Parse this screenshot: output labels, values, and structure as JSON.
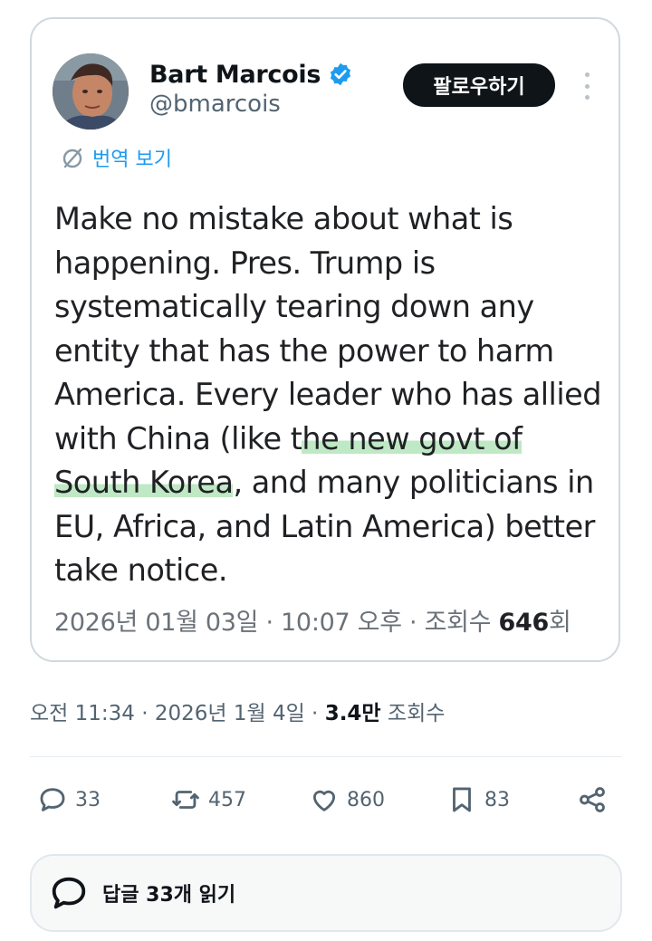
{
  "colors": {
    "accent": "#1d9bf0",
    "text_primary": "#0f1419",
    "text_secondary": "#536471",
    "border": "#cfd9de",
    "highlight": "#bfe8c4"
  },
  "embedded_post": {
    "author_name": "Bart Marcois",
    "verified_icon": "verified-badge-icon",
    "handle": "@bmarcois",
    "follow_label": "팔로우하기",
    "more_icon": "more-vertical-icon",
    "translate_label": "번역 보기",
    "body": {
      "part1": "Make no mistake about what is happening. Pres. Trump is systematically tearing down any entity that has the power to harm America. Every leader who has allied with China (like t",
      "highlight": "he new govt of South Korea",
      "part2": ", and many politicians in EU, Africa, and Latin America) better take notice."
    },
    "meta_prefix": "2026년 01월 03일 · 10:07 오후 · 조회수 ",
    "views": "646",
    "views_suffix": "회"
  },
  "post_meta": {
    "time": "오전 11:34 · 2026년 1월 4일 · ",
    "views": "3.4만",
    "views_label": " 조회수"
  },
  "actions": {
    "reply": {
      "icon": "reply-icon",
      "count": "33"
    },
    "repost": {
      "icon": "repost-icon",
      "count": "457"
    },
    "like": {
      "icon": "heart-icon",
      "count": "860"
    },
    "bookmark": {
      "icon": "bookmark-icon",
      "count": "83"
    },
    "share": {
      "icon": "share-icon"
    }
  },
  "read_replies": {
    "icon": "reply-icon",
    "label": "답글 33개 읽기"
  }
}
